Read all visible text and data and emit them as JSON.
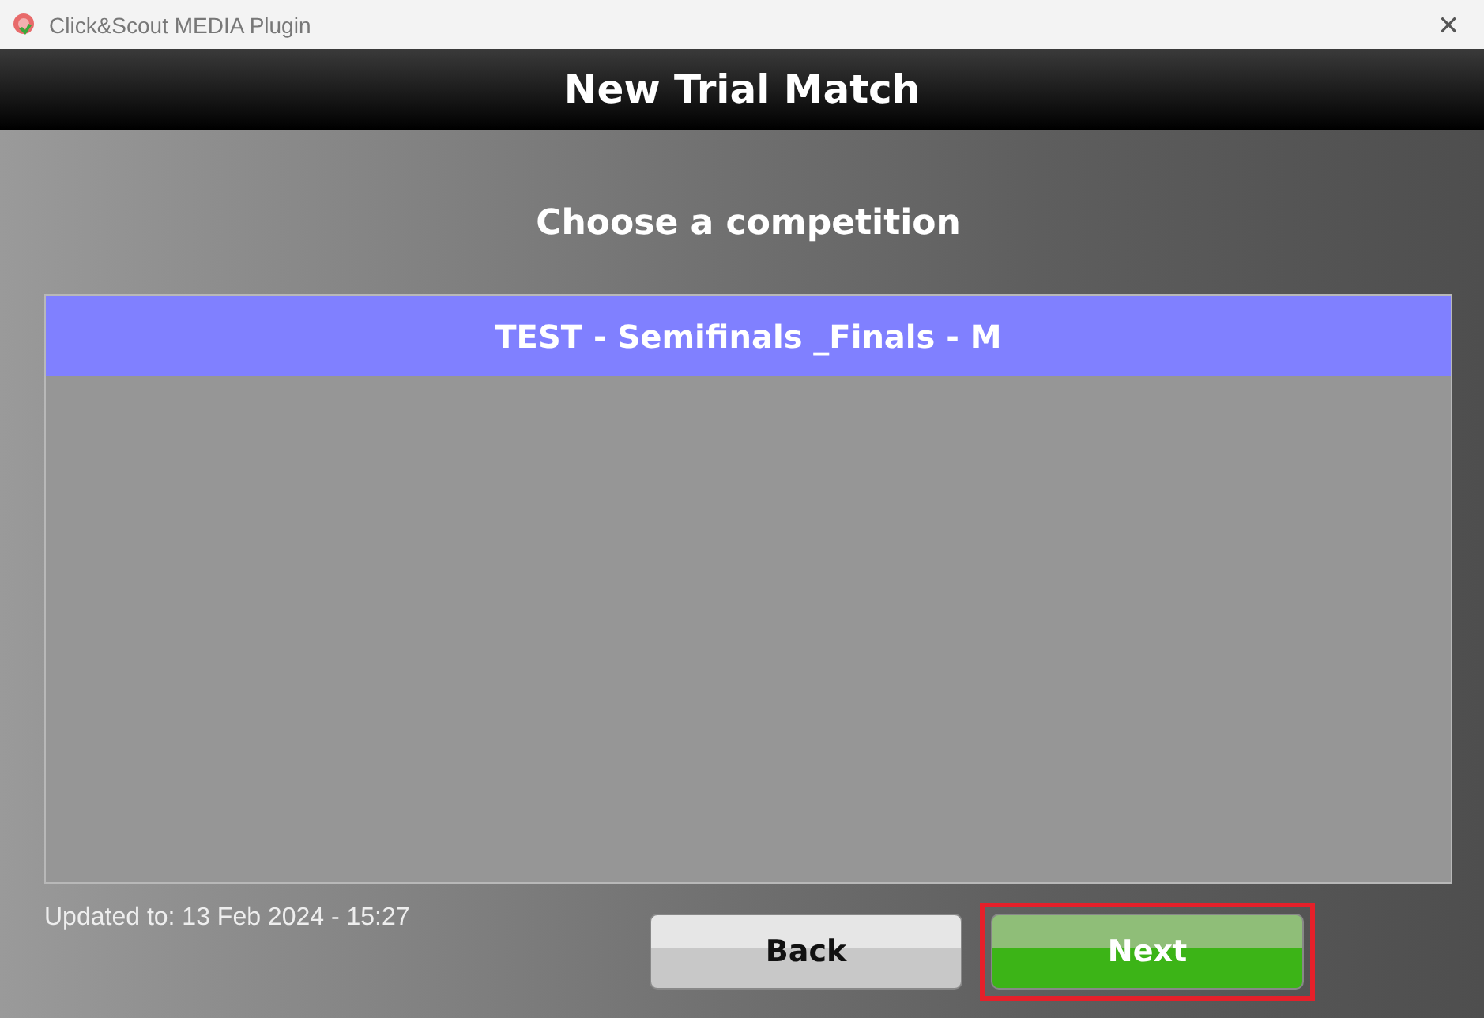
{
  "window": {
    "title": "Click&Scout MEDIA Plugin",
    "close": "×"
  },
  "header": {
    "title": "New Trial Match"
  },
  "prompt": "Choose a competition",
  "competitions": [
    {
      "label": "TEST - Semifinals _Finals - M",
      "selected": true
    }
  ],
  "updated": "Updated to: 13 Feb 2024 - 15:27",
  "buttons": [
    {
      "label": "Back",
      "kind": "secondary",
      "highlighted": false
    },
    {
      "label": "Next",
      "kind": "primary",
      "highlighted": true
    }
  ]
}
